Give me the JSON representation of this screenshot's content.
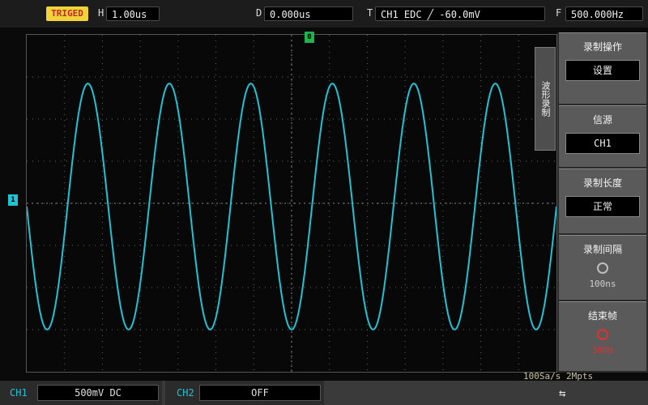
{
  "status_bar": {
    "run_state": "TRIGED",
    "timebase_label": "H",
    "timebase": "1.00us",
    "offset_label": "D",
    "offset": "0.000us",
    "trigger_label": "T",
    "trigger": "CH1 EDC ╱ -60.0mV",
    "frequency_label": "F",
    "frequency": "500.000Hz"
  },
  "markers": {
    "trigger": "0",
    "channel": "1"
  },
  "sample_info": "100Sa/s 2Mpts",
  "waveform": {
    "color": "#22c2d4",
    "cycles": 6.5,
    "amplitude_fraction": 0.73
  },
  "menu": {
    "tab": "波形录制",
    "items": [
      {
        "title": "录制操作",
        "value": "设置"
      },
      {
        "title": "信源",
        "value": "CH1"
      },
      {
        "title": "录制长度",
        "value": "正常"
      },
      {
        "title": "录制间隔",
        "value": "100ns",
        "knob": "knob-icon"
      },
      {
        "title": "结束帧",
        "value": "3000",
        "knob": "knob-icon",
        "accent": "#e03030"
      }
    ]
  },
  "bottom_bar": {
    "ch1_label": "CH1",
    "ch1_value": "500mV DC",
    "ch2_label": "CH2",
    "ch2_value": "OFF",
    "usb_icon": "usb-icon"
  }
}
